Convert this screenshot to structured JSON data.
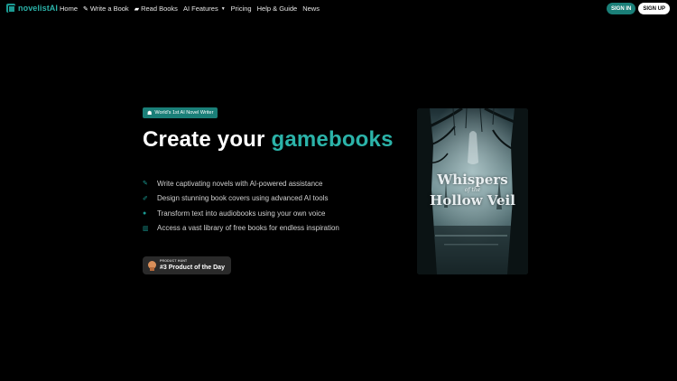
{
  "brand": {
    "name": "novelistAI"
  },
  "nav": {
    "items": [
      {
        "label": "Home",
        "icon": ""
      },
      {
        "label": "Write a Book",
        "icon": "pencil-icon"
      },
      {
        "label": "Read Books",
        "icon": "book-icon"
      },
      {
        "label": "AI Features",
        "icon": "",
        "dropdown": true
      },
      {
        "label": "Pricing",
        "icon": ""
      },
      {
        "label": "Help & Guide",
        "icon": ""
      },
      {
        "label": "News",
        "icon": ""
      }
    ],
    "sign_in": "SIGN IN",
    "sign_up": "SIGN UP"
  },
  "hero": {
    "badge": "World's 1st AI Novel Writer",
    "headline_prefix": "Create your",
    "headline_accent": "gamebooks",
    "features": [
      {
        "icon": "pencil-icon",
        "text": "Write captivating novels with AI-powered assistance"
      },
      {
        "icon": "brush-icon",
        "text": "Design stunning book covers using advanced AI tools"
      },
      {
        "icon": "microphone-icon",
        "text": "Transform text into audiobooks using your own voice"
      },
      {
        "icon": "book-open-icon",
        "text": "Access a vast library of free books for endless inspiration"
      }
    ],
    "product_hunt": {
      "small": "PRODUCT HUNT",
      "big": "#3 Product of the Day"
    }
  },
  "cover": {
    "line1": "Whispers",
    "line2": "of the",
    "line3": "Hollow Veil"
  },
  "colors": {
    "accent": "#2bb3a9",
    "accent_dark": "#1a7f78",
    "background": "#000000"
  }
}
